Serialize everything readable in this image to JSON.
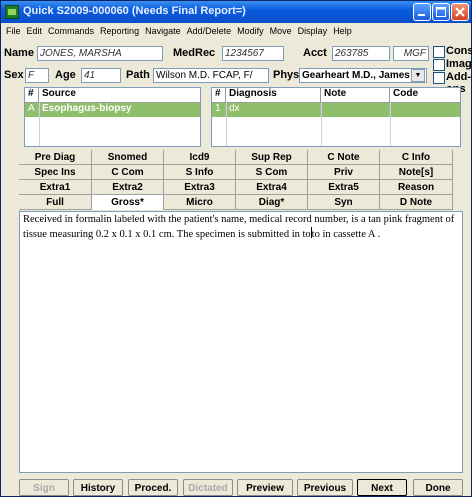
{
  "window": {
    "title": "Quick S2009-000060 (Needs Final Report=)"
  },
  "menu": [
    "File",
    "Edit",
    "Commands",
    "Reporting",
    "Navigate",
    "Add/Delete",
    "Modify",
    "Move",
    "Display",
    "Help"
  ],
  "patient": {
    "name_label": "Name",
    "name": "JONES, MARSHA",
    "medrec_label": "MedRec",
    "medrec": "1234567",
    "acct_label": "Acct",
    "acct": "263785",
    "mgr": "MGF",
    "sex_label": "Sex",
    "sex": "F",
    "age_label": "Age",
    "age": "41",
    "path_label": "Path",
    "path": "Wilson M.D. FCAP, F/",
    "phys_label": "Phys",
    "phys": "Gearheart M.D., James"
  },
  "options": {
    "consults": "Consults",
    "images": "Images",
    "addons": "Add-ons"
  },
  "source_table": {
    "headers": [
      "#",
      "Source"
    ],
    "rows": [
      [
        "A",
        "Esophagus-biopsy"
      ]
    ]
  },
  "diagnosis_table": {
    "headers": [
      "#",
      "Diagnosis",
      "Note",
      "Code"
    ],
    "rows": [
      [
        "1",
        "dx",
        "",
        ""
      ]
    ]
  },
  "tabs": [
    [
      "Pre Diag",
      "Snomed",
      "Icd9",
      "Sup Rep",
      "C Note",
      "C Info"
    ],
    [
      "Spec Ins",
      "C Com",
      "S Info",
      "S Com",
      "Priv",
      "Note[s]"
    ],
    [
      "Extra1",
      "Extra2",
      "Extra3",
      "Extra4",
      "Extra5",
      "Reason"
    ],
    [
      "Full",
      "Gross*",
      "Micro",
      "Diag*",
      "Syn",
      "D Note"
    ]
  ],
  "active_tab": "Gross*",
  "editor": {
    "text_before": "Received in formalin labeled with the patient's name, medical record number,  is a tan pink fragment of tissue measuring  0.2 x 0.1 x 0.1  cm.  The specimen is submitted in to",
    "text_after": "to in cassette A ."
  },
  "buttons": {
    "sign": "Sign",
    "history": "History",
    "proced": "Proced.",
    "dictated": "Dictated",
    "preview": "Preview",
    "previous": "Previous",
    "next": "Next",
    "done": "Done"
  },
  "colors": {
    "title_bar": "#0b5ce0",
    "selected_row": "#8fbf6a"
  }
}
